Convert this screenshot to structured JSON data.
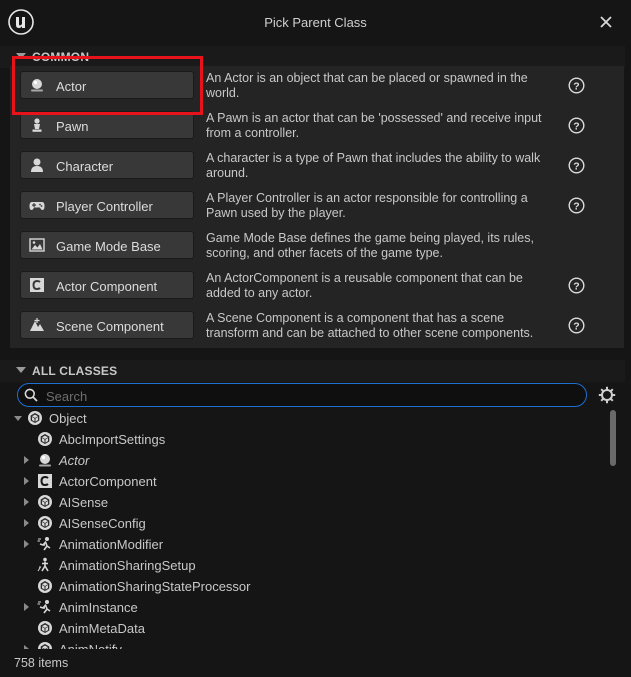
{
  "window": {
    "title": "Pick Parent Class"
  },
  "common": {
    "header": "COMMON",
    "items": [
      {
        "label": "Actor",
        "icon": "actor-icon",
        "description": "An Actor is an object that can be placed or spawned in the world."
      },
      {
        "label": "Pawn",
        "icon": "pawn-icon",
        "description": "A Pawn is an actor that can be 'possessed' and receive input from a controller."
      },
      {
        "label": "Character",
        "icon": "character-icon",
        "description": "A character is a type of Pawn that includes the ability to walk around."
      },
      {
        "label": "Player Controller",
        "icon": "gamepad-icon",
        "description": "A Player Controller is an actor responsible for controlling a Pawn used by the player."
      },
      {
        "label": "Game Mode Base",
        "icon": "game-mode-icon",
        "description": "Game Mode Base defines the game being played, its rules, scoring, and other facets of the game type."
      },
      {
        "label": "Actor Component",
        "icon": "actor-component-icon",
        "description": "An ActorComponent is a reusable component that can be added to any actor."
      },
      {
        "label": "Scene Component",
        "icon": "scene-component-icon",
        "description": "A Scene Component is a component that has a scene transform and can be attached to other scene components."
      }
    ]
  },
  "all_classes": {
    "header": "ALL CLASSES",
    "search": {
      "placeholder": "Search",
      "value": ""
    },
    "tree": [
      {
        "label": "Object",
        "icon": "object-icon",
        "expander": "down",
        "indent": 0,
        "italic": false
      },
      {
        "label": "AbcImportSettings",
        "icon": "object-icon",
        "expander": "none",
        "indent": 1,
        "italic": false
      },
      {
        "label": "Actor",
        "icon": "actor-icon",
        "expander": "right",
        "indent": 1,
        "italic": true
      },
      {
        "label": "ActorComponent",
        "icon": "actor-component-icon",
        "expander": "right",
        "indent": 1,
        "italic": false
      },
      {
        "label": "AISense",
        "icon": "object-icon",
        "expander": "right",
        "indent": 1,
        "italic": false
      },
      {
        "label": "AISenseConfig",
        "icon": "object-icon",
        "expander": "right",
        "indent": 1,
        "italic": false
      },
      {
        "label": "AnimationModifier",
        "icon": "animation-icon",
        "expander": "right",
        "indent": 1,
        "italic": false
      },
      {
        "label": "AnimationSharingSetup",
        "icon": "animation-sharing-icon",
        "expander": "none",
        "indent": 1,
        "italic": false
      },
      {
        "label": "AnimationSharingStateProcessor",
        "icon": "object-icon",
        "expander": "none",
        "indent": 1,
        "italic": false
      },
      {
        "label": "AnimInstance",
        "icon": "animation-icon",
        "expander": "right",
        "indent": 1,
        "italic": false
      },
      {
        "label": "AnimMetaData",
        "icon": "object-icon",
        "expander": "none",
        "indent": 1,
        "italic": false
      },
      {
        "label": "AnimNotify",
        "icon": "object-icon",
        "expander": "right",
        "indent": 1,
        "italic": false
      }
    ],
    "item_count": "758 items"
  },
  "colors": {
    "highlight": "#e8121b",
    "search_focus": "#1f6fd0"
  }
}
